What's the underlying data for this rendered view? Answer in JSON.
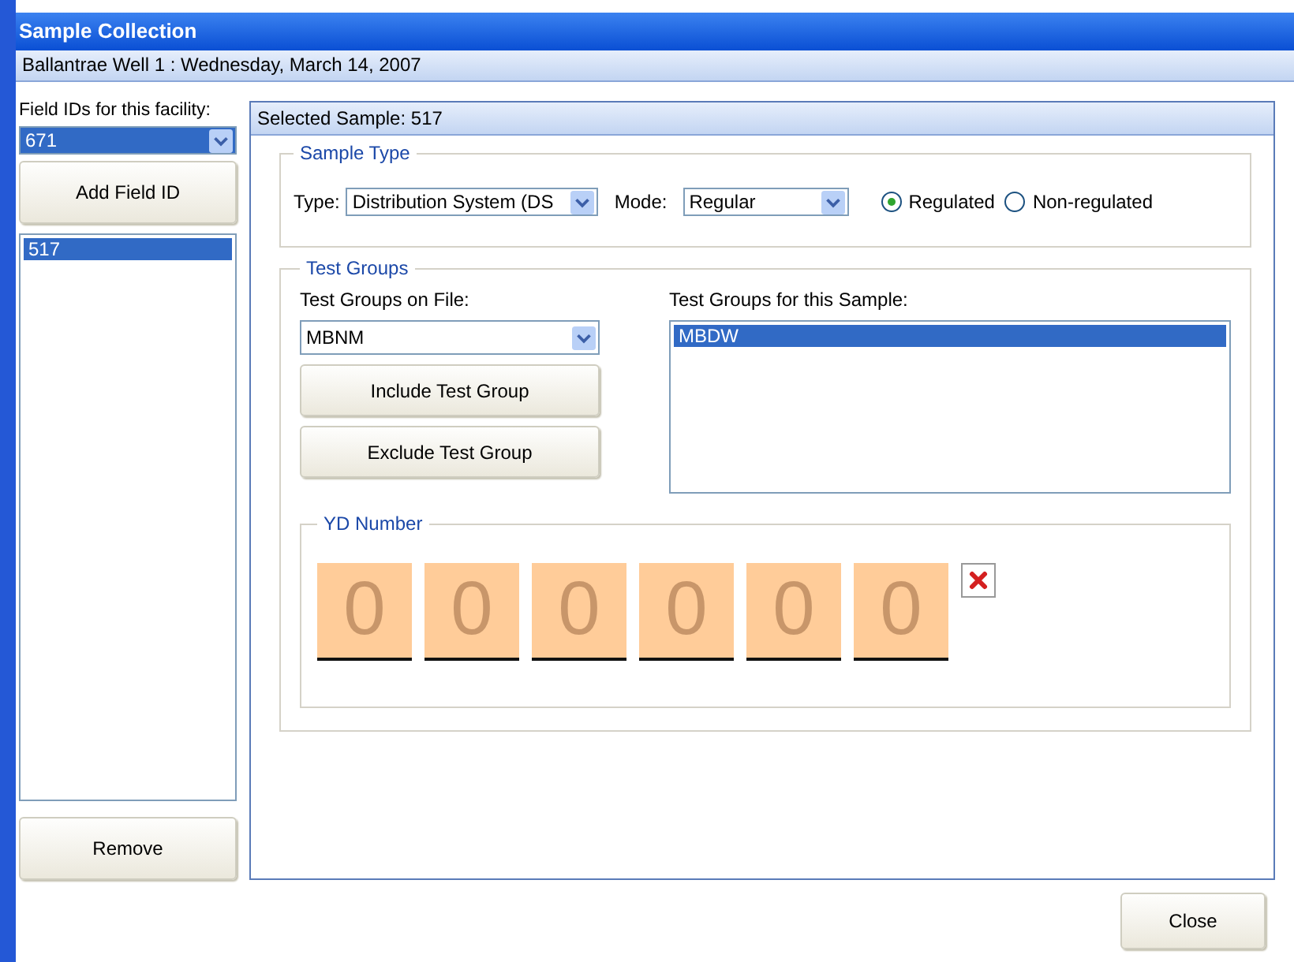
{
  "window": {
    "title": "Sample Collection",
    "subtitle": "Ballantrae Well 1 : Wednesday, March 14, 2007"
  },
  "field_ids": {
    "label": "Field IDs for this facility:",
    "value": "671",
    "add_button": "Add Field ID",
    "items": [
      {
        "label": "517",
        "selected": true
      }
    ],
    "remove_button": "Remove"
  },
  "selected_sample": {
    "header": "Selected Sample: 517",
    "sample_type": {
      "legend": "Sample Type",
      "type_label": "Type:",
      "type_value": "Distribution System (DS",
      "mode_label": "Mode:",
      "mode_value": "Regular",
      "radios": [
        {
          "label": "Regulated",
          "selected": true
        },
        {
          "label": "Non-regulated",
          "selected": false
        }
      ]
    },
    "test_groups": {
      "legend": "Test Groups",
      "on_file_label": "Test Groups on File:",
      "on_file_value": "MBNM",
      "include_button": "Include Test Group",
      "exclude_button": "Exclude Test Group",
      "sample_label": "Test Groups for this Sample:",
      "items": [
        {
          "label": "MBDW",
          "selected": true
        }
      ]
    },
    "yd_number": {
      "legend": "YD Number",
      "digits": [
        "0",
        "0",
        "0",
        "0",
        "0",
        "0"
      ]
    }
  },
  "close_button": "Close"
}
